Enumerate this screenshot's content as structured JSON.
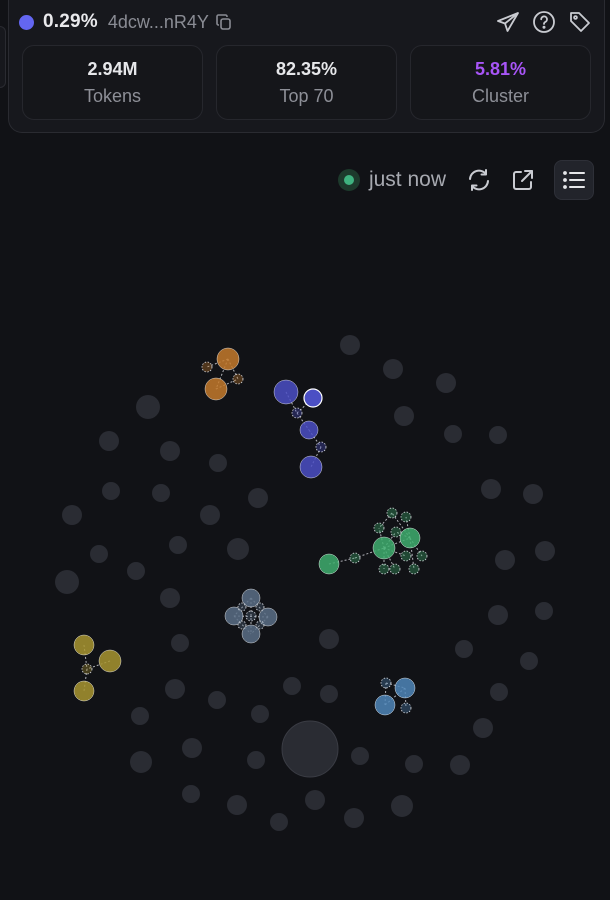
{
  "header": {
    "holder_percent": "0.29%",
    "address": "4dcw...nR4Y",
    "accent_color": "#6366f1"
  },
  "stats": [
    {
      "value": "2.94M",
      "label": "Tokens"
    },
    {
      "value": "82.35%",
      "label": "Top 70"
    },
    {
      "value": "5.81%",
      "label": "Cluster",
      "color": "#a855f7"
    }
  ],
  "toolbar": {
    "updated_text": "just now",
    "live_color": "#3fb27f"
  },
  "icons": {
    "copy": "copy-icon",
    "telegram": "send-icon",
    "help": "question-icon",
    "tag": "tag-icon",
    "refresh": "refresh-icon",
    "external": "external-link-icon",
    "list": "list-icon"
  },
  "bubble_map": {
    "cluster_colors": {
      "orange": "#c47a2c",
      "indigo": "#4b4fc4",
      "green": "#3fae6e",
      "slate": "#5a6f86",
      "olive": "#a89530",
      "blue": "#4f86b8",
      "neutral": "#2a2c33"
    }
  }
}
